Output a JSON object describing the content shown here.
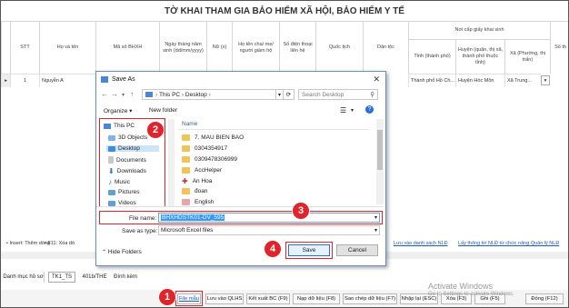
{
  "page": {
    "title": "TỜ KHAI THAM GIA BẢO HIỂM XÃ HỘI, BẢO HIỂM Y TẾ"
  },
  "grid": {
    "headers": {
      "stt": "STT",
      "name": "Họ và tên",
      "bhxh": "Mã số BHXH",
      "dob": "Ngày tháng năm sinh (dd/mm/yyyy)",
      "gender": "Nữ (x)",
      "guardian": "Họ tên cha/ mẹ/ người giám hộ",
      "phone": "Số điện thoại liên hệ",
      "nationality": "Quốc tịch",
      "ethnicity": "Dân tộc",
      "birth_cert_group": "Nơi cấp giấy khai sinh",
      "province": "Tỉnh (thành phố)",
      "district": "Huyện (quận, thị xã, thành phố thuộc tỉnh)",
      "ward": "Xã (Phường, thị trấn)",
      "extra": "Số th"
    },
    "row1": {
      "index": "1",
      "stt": "1",
      "name": "Nguyễn A",
      "province": "Thành phố Hồ Ch...",
      "district": "Huyện Hóc Môn",
      "ward": "Xã Trung..."
    }
  },
  "hints": {
    "insert": "Insert: Thêm dòng",
    "f11": "F11: Xóa dò",
    "link1": "Lưu vào danh sách NLĐ",
    "link2": "Lấy thông tin NLĐ từ chức năng Quản lý NLĐ"
  },
  "tabs": [
    "Danh mục hồ sơ",
    "TK1_TS",
    "401b/THE",
    "Đính kèm"
  ],
  "bottom_buttons": {
    "file_mau": "File mẫu",
    "luu_qlhs": "Lưu vào QLHS",
    "ket_xuat": "Kết xuất BC (F9)",
    "nap_du_lieu": "Nạp dữ liệu (F8)",
    "sao_chep": "Sao chép dữ liệu (F7)",
    "nhap_lai": "Nhập lại (ESC)",
    "xoa": "Xóa (F3)",
    "ghi": "Ghi (F5)",
    "dong": "Đóng (F12)"
  },
  "watermark": {
    "line1": "Activate Windows",
    "line2": "Go to Settings to activate Windows."
  },
  "dialog": {
    "title": "Save As",
    "close": "✕",
    "address": [
      "This PC",
      "Desktop"
    ],
    "search_placeholder": "Search Desktop",
    "organize": "Organize ▾",
    "new_folder": "New folder",
    "nav_items": [
      "This PC",
      "3D Objects",
      "Desktop",
      "Documents",
      "Downloads",
      "Music",
      "Pictures",
      "Videos"
    ],
    "column_name": "Name",
    "files": [
      "7. MAU BIEN BAO",
      "0304354917",
      "0309478306999",
      "AccHelper",
      "An Hoa",
      "đoan",
      "English"
    ],
    "file_name_label": "File name:",
    "file_name_value": "BHXHDSTK01-DV_595",
    "save_type_label": "Save as type:",
    "save_type_value": "Microsoft Excel files",
    "hide_folders": "Hide Folders",
    "save": "Save",
    "cancel": "Cancel"
  },
  "annotations": [
    "1",
    "2",
    "3",
    "4"
  ],
  "colors": {
    "highlight": "#e0242a",
    "dialog_border": "#6a8fbf",
    "selection": "#3399ff",
    "link": "#1f5fbf"
  }
}
